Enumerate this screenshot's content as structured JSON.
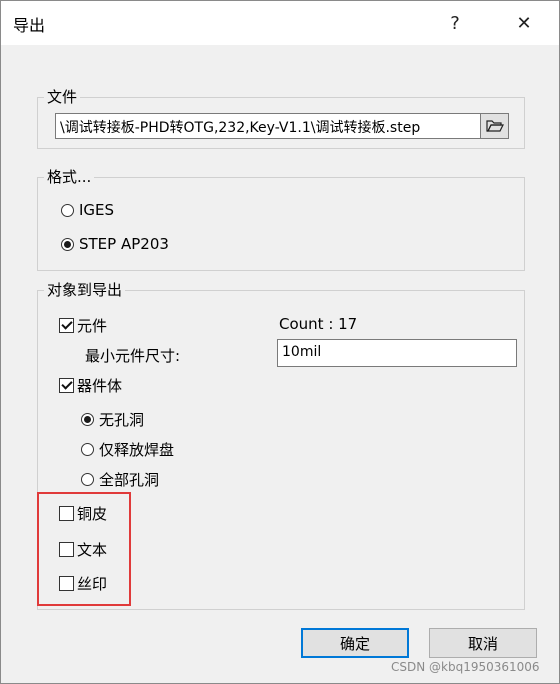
{
  "window": {
    "title": "导出",
    "help_label": "?",
    "close_label": "✕"
  },
  "file_group": {
    "legend": "文件",
    "path_value": "\\调试转接板-PHD转OTG,232,Key-V1.1\\调试转接板.step",
    "browse_icon": "folder-open-icon"
  },
  "format_group": {
    "legend": "格式...",
    "options": [
      {
        "label": "IGES",
        "selected": false
      },
      {
        "label": "STEP AP203",
        "selected": true
      }
    ]
  },
  "objects_group": {
    "legend": "对象到导出",
    "components": {
      "label": "元件",
      "checked": true
    },
    "count_text": "Count : 17",
    "min_size_label": "最小元件尺寸:",
    "min_size_value": "10mil",
    "bodies": {
      "label": "器件体",
      "checked": true
    },
    "hole_options": [
      {
        "label": "无孔洞",
        "selected": true
      },
      {
        "label": "仅释放焊盘",
        "selected": false
      },
      {
        "label": "全部孔洞",
        "selected": false
      }
    ],
    "copper": {
      "label": "铜皮",
      "checked": false
    },
    "text": {
      "label": "文本",
      "checked": false
    },
    "silk": {
      "label": "丝印",
      "checked": false
    }
  },
  "buttons": {
    "ok": "确定",
    "cancel": "取消"
  },
  "watermark": "CSDN @kbq1950361006",
  "colors": {
    "highlight_border": "#e03a3a",
    "default_button_border": "#0078d7"
  }
}
